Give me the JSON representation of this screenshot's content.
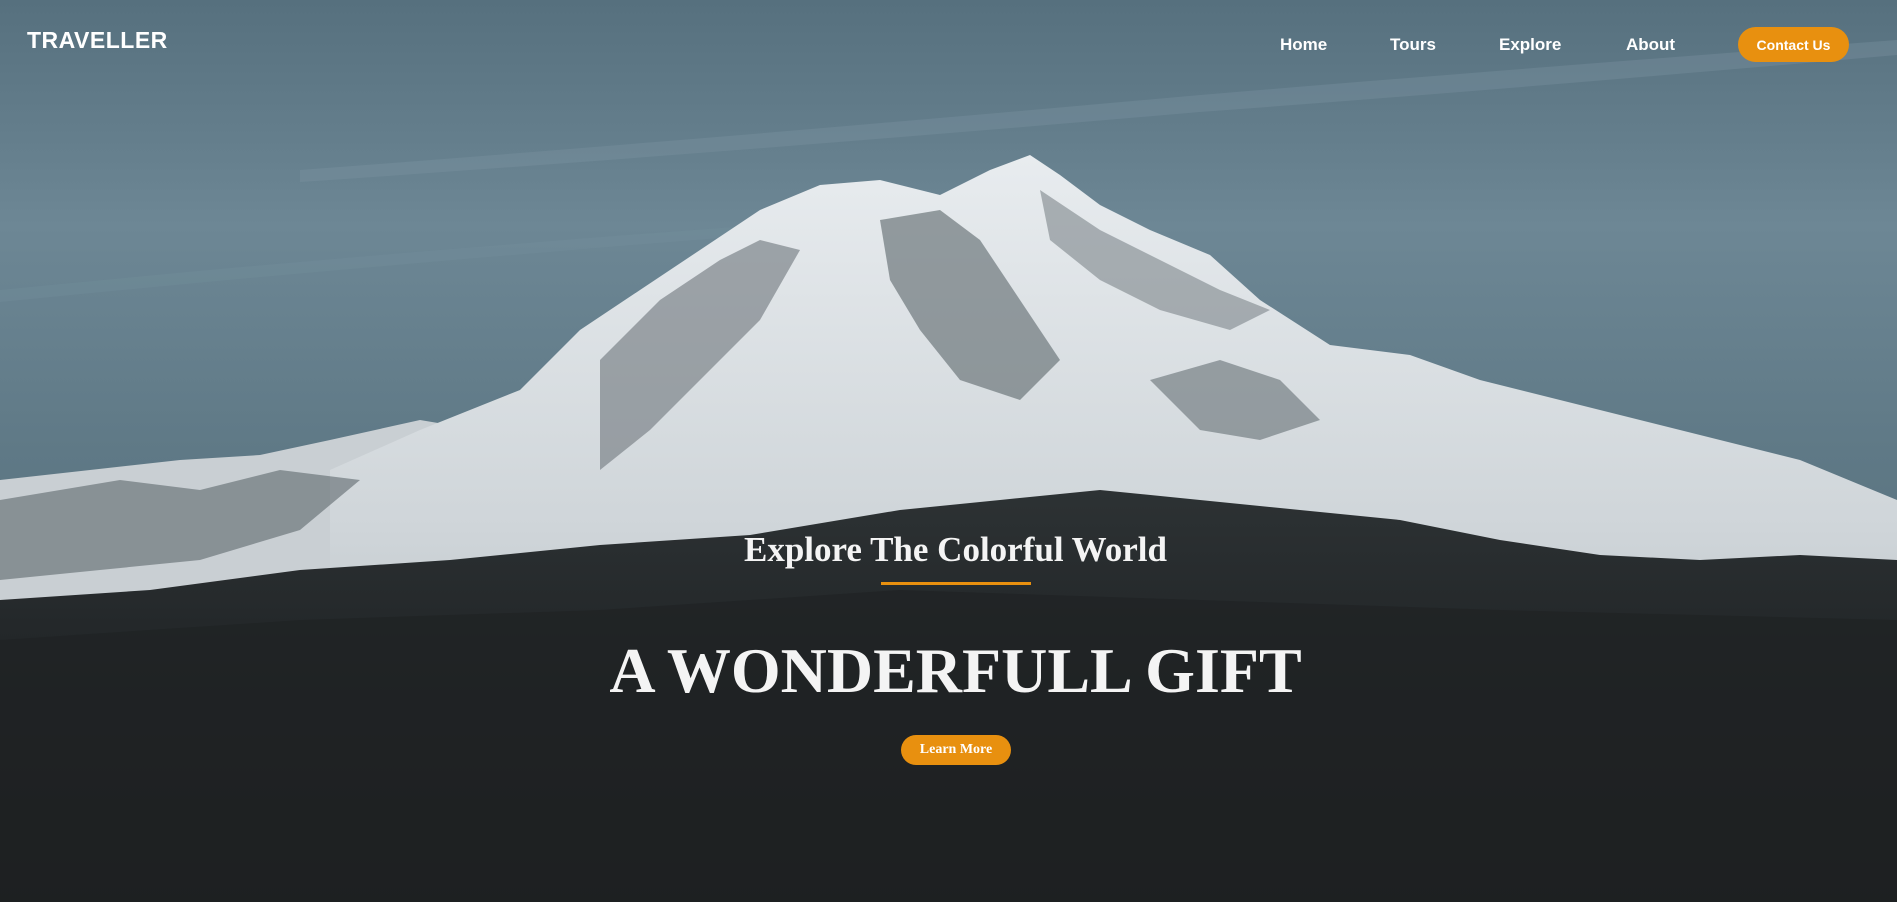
{
  "brand": {
    "logo_text": "TRAVELLER"
  },
  "nav": {
    "links": [
      {
        "label": "Home"
      },
      {
        "label": "Tours"
      },
      {
        "label": "Explore"
      },
      {
        "label": "About"
      }
    ],
    "contact_label": "Contact Us"
  },
  "hero": {
    "tagline": "Explore The Colorful World",
    "headline": "A WONDERFULL GIFT",
    "cta_label": "Learn More",
    "background_image": "snow-capped-mountain-photo"
  },
  "colors": {
    "accent": "#e8900f",
    "text": "#ffffff",
    "sky": "#6b8694",
    "forest": "#1e2122"
  }
}
